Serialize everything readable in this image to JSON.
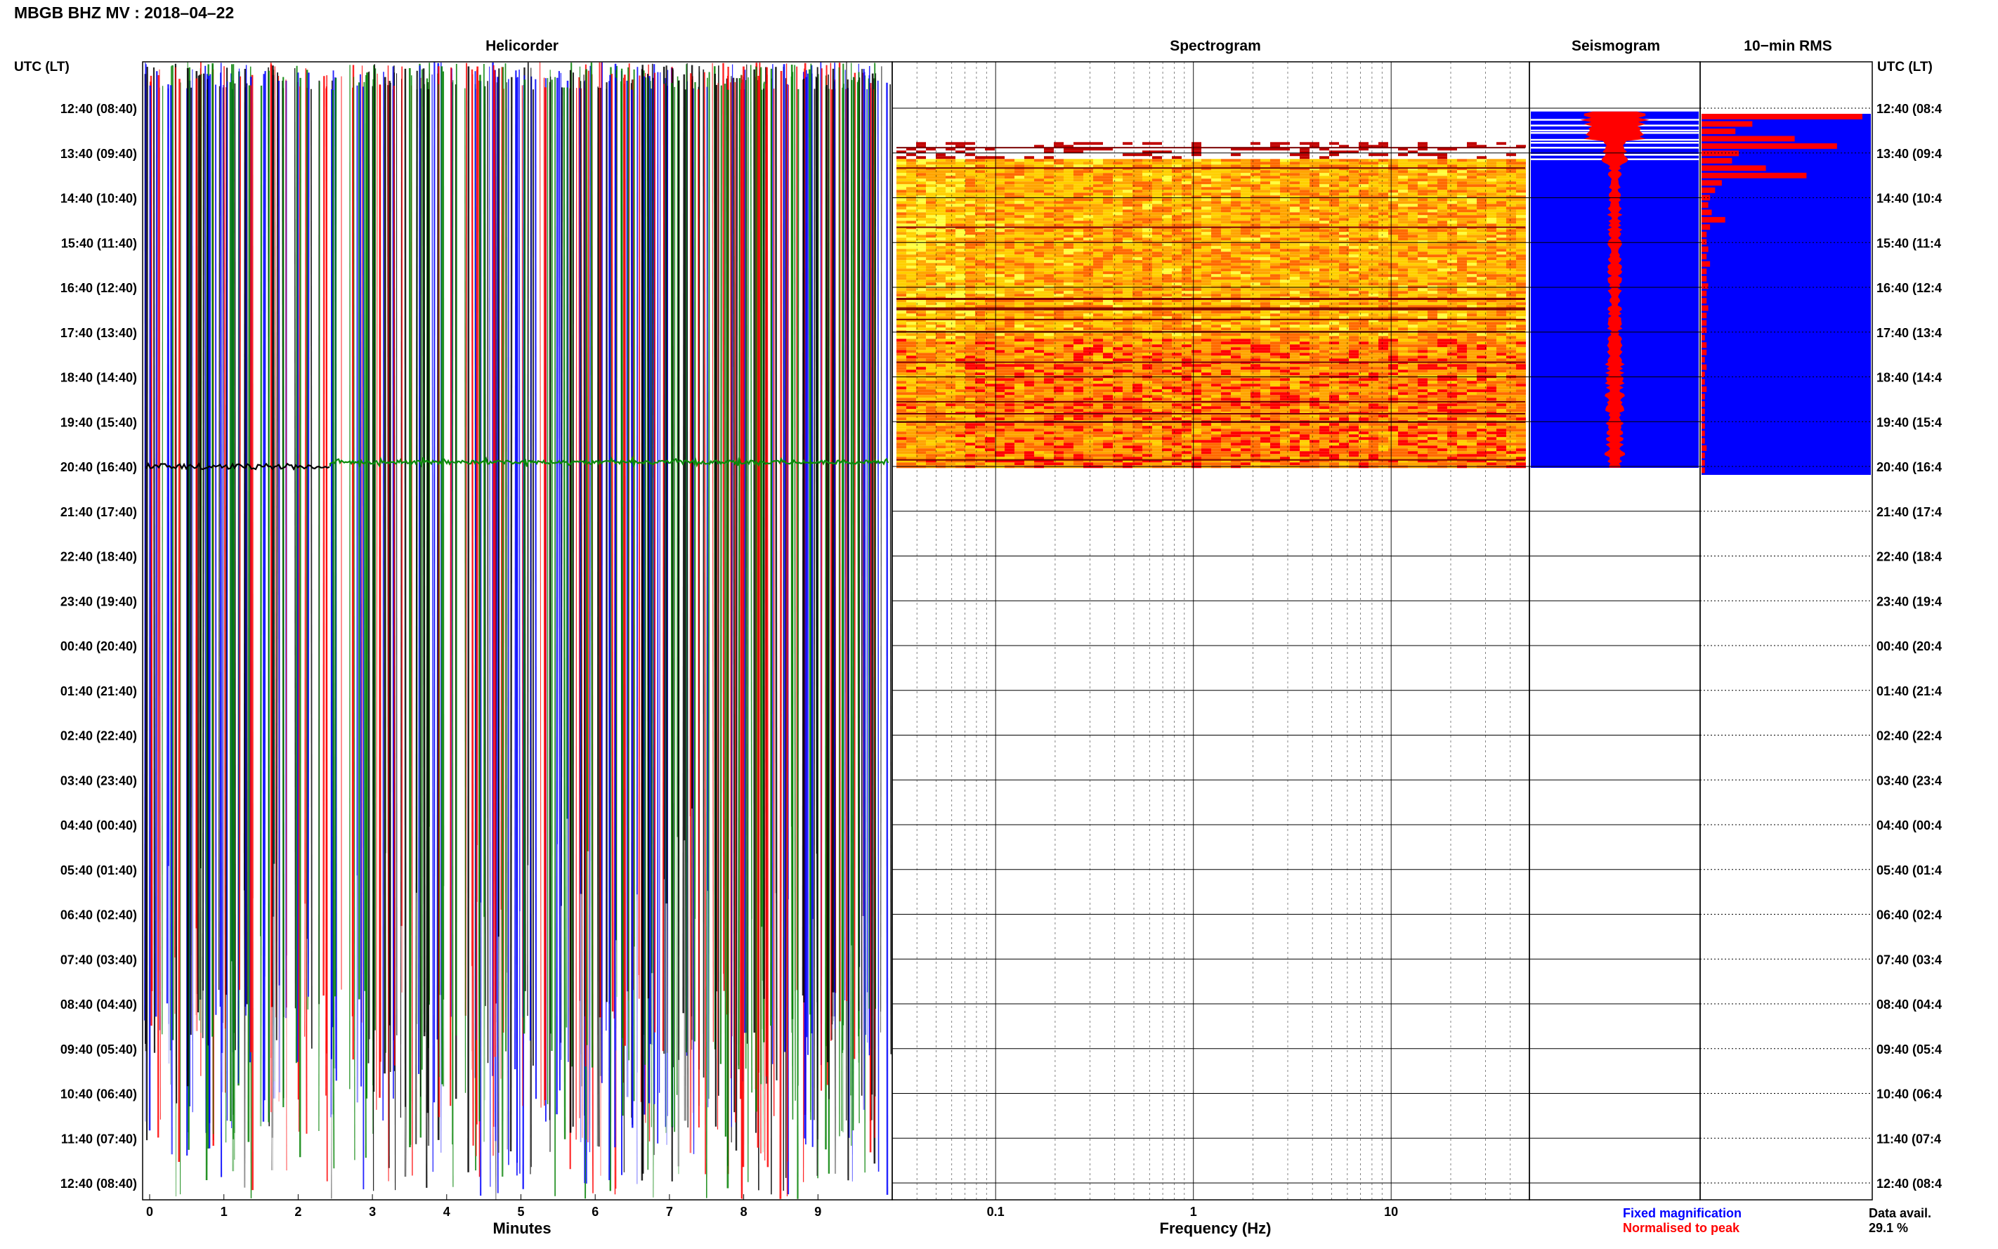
{
  "header": {
    "title": "MBGB BHZ MV : 2018–04–22",
    "utc_label_left": "UTC (LT)",
    "utc_label_right": "UTC (LT)"
  },
  "panels": {
    "helicorder": "Helicorder",
    "spectrogram": "Spectrogram",
    "seismogram": "Seismogram",
    "rms": "10−min RMS"
  },
  "legend": {
    "fixed": "Fixed magnification",
    "normalised": "Normalised to peak",
    "fixed_color": "#0000ff",
    "normalised_color": "#ff0000"
  },
  "data_avail": {
    "label": "Data avail.",
    "value": "29.1 %"
  },
  "chart_data": [
    {
      "type": "line",
      "title": "Helicorder",
      "xlabel": "Minutes",
      "x_ticks": [
        0,
        1,
        2,
        3,
        4,
        5,
        6,
        7,
        8,
        9
      ],
      "xlim": [
        0,
        10
      ],
      "row_labels_left": [
        "12:40 (08:40)",
        "13:40 (09:40)",
        "14:40 (10:40)",
        "15:40 (11:40)",
        "16:40 (12:40)",
        "17:40 (13:40)",
        "18:40 (14:40)",
        "19:40 (15:40)",
        "20:40 (16:40)",
        "21:40 (17:40)",
        "22:40 (18:40)",
        "23:40 (19:40)",
        "00:40 (20:40)",
        "01:40 (21:40)",
        "02:40 (22:40)",
        "03:40 (23:40)",
        "04:40 (00:40)",
        "05:40 (01:40)",
        "06:40 (02:40)",
        "07:40 (03:40)",
        "08:40 (04:40)",
        "09:40 (05:40)",
        "10:40 (06:40)",
        "11:40 (07:40)",
        "12:40 (08:40)"
      ],
      "trace_colors": [
        "#000000",
        "#ff0000",
        "#0000ff",
        "#008000"
      ]
    },
    {
      "type": "heatmap",
      "title": "Spectrogram",
      "xlabel": "Frequency (Hz)",
      "x_scale": "log",
      "x_ticks": [
        0.1,
        1,
        10
      ],
      "x_tick_labels": [
        "0.1",
        "1",
        "10"
      ],
      "xlim": [
        0.03,
        50
      ],
      "data_hours": [
        0.6,
        8.0
      ],
      "colors": [
        "#ff0000",
        "#ff6a00",
        "#ffa500",
        "#ffd000",
        "#ffff40"
      ]
    },
    {
      "type": "area",
      "title": "Seismogram",
      "fixed_color": "#0000ff",
      "normalised_color": "#ff0000",
      "data_hours": [
        0.2,
        8.0
      ]
    },
    {
      "type": "bar",
      "title": "10−min RMS",
      "row_labels_right": [
        "12:40 (08:4",
        "13:40 (09:4",
        "14:40 (10:4",
        "15:40 (11:4",
        "16:40 (12:4",
        "17:40 (13:4",
        "18:40 (14:4",
        "19:40 (15:4",
        "20:40 (16:4",
        "21:40 (17:4",
        "22:40 (18:4",
        "23:40 (19:4",
        "00:40 (20:4",
        "01:40 (21:4",
        "02:40 (22:4",
        "03:40 (23:4",
        "04:40 (00:4",
        "05:40 (01:4",
        "06:40 (02:4",
        "07:40 (03:4",
        "08:40 (04:4",
        "09:40 (05:4",
        "10:40 (06:4",
        "11:40 (07:4",
        "12:40 (08:4"
      ],
      "rms_fraction": [
        0.95,
        0.3,
        0.2,
        0.55,
        0.8,
        0.22,
        0.18,
        0.38,
        0.62,
        0.12,
        0.08,
        0.05,
        0.04,
        0.06,
        0.14,
        0.05,
        0.03,
        0.03,
        0.04,
        0.03,
        0.05,
        0.03,
        0.03,
        0.04,
        0.03,
        0.03,
        0.04,
        0.03,
        0.03,
        0.03,
        0.02,
        0.03,
        0.03,
        0.02,
        0.03,
        0.02,
        0.02,
        0.03,
        0.02,
        0.02,
        0.02,
        0.02,
        0.02,
        0.02,
        0.02,
        0.03,
        0.02,
        0.02,
        0.02
      ]
    }
  ]
}
